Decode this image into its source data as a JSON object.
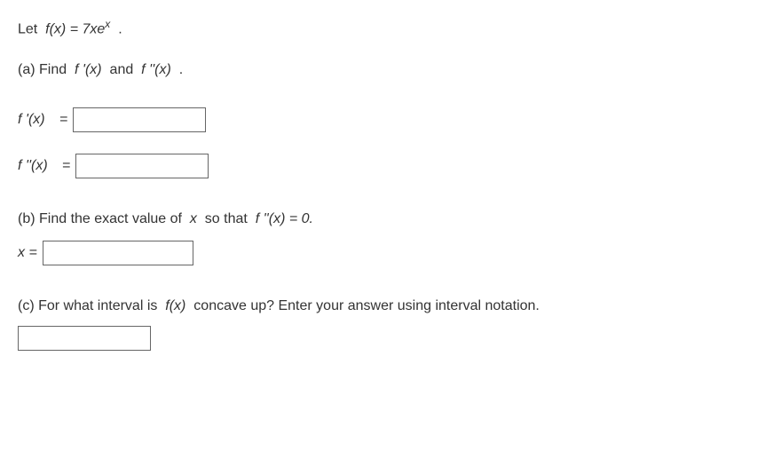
{
  "intro": {
    "let": "Let",
    "fn": "f(x) = 7xe",
    "exp": "x",
    "dot": "."
  },
  "a": {
    "label": "(a) Find",
    "d1": "f '(x)",
    "and": "and",
    "d2": "f ''(x)",
    "dot": "."
  },
  "row1": {
    "label": "f '(x)",
    "eq": "="
  },
  "row2": {
    "label": "f ''(x)",
    "eq": "="
  },
  "b": {
    "label": "(b) Find the exact value of",
    "x": "x",
    "sothat": "so that",
    "fpp": "f ''(x) = 0.",
    "xeq": "x ="
  },
  "c": {
    "label": "(c) For what interval is",
    "fx": "f(x)",
    "rest": "concave up? Enter your answer using interval notation."
  },
  "answers": {
    "fprime": "",
    "fpp": "",
    "xval": "",
    "interval": ""
  }
}
